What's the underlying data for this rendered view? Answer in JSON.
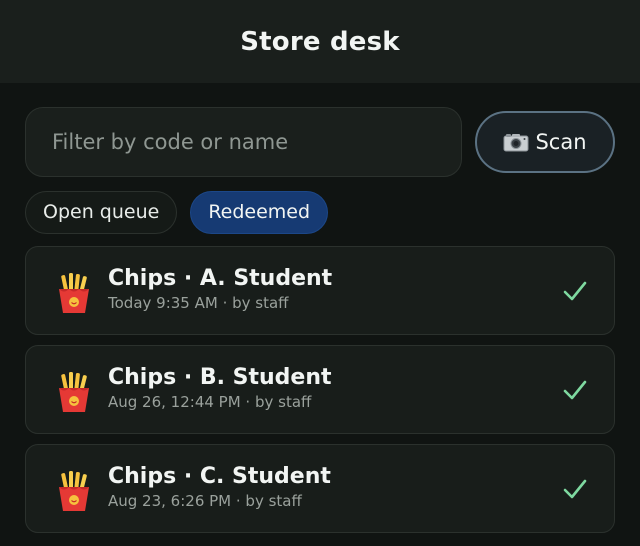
{
  "header": {
    "title": "Store desk"
  },
  "search": {
    "placeholder": "Filter by code or name",
    "value": ""
  },
  "scan_button": {
    "icon": "camera-icon",
    "label": "Scan"
  },
  "tabs": [
    {
      "label": "Open queue",
      "selected": false
    },
    {
      "label": "Redeemed",
      "selected": true
    }
  ],
  "items": [
    {
      "icon": "fries-icon",
      "title": "Chips · A. Student",
      "subtitle": "Today 9:35 AM · by staff",
      "status": "check-icon"
    },
    {
      "icon": "fries-icon",
      "title": "Chips · B. Student",
      "subtitle": "Aug 26, 12:44 PM · by staff",
      "status": "check-icon"
    },
    {
      "icon": "fries-icon",
      "title": "Chips · C. Student",
      "subtitle": "Aug 23, 6:26 PM · by staff",
      "status": "check-icon"
    }
  ],
  "colors": {
    "background": "#101412",
    "header": "#1a1f1c",
    "card": "#181d1a",
    "selected_tab": "#163a73",
    "check": "#7ed9a0",
    "scan_border": "#5b7283"
  }
}
